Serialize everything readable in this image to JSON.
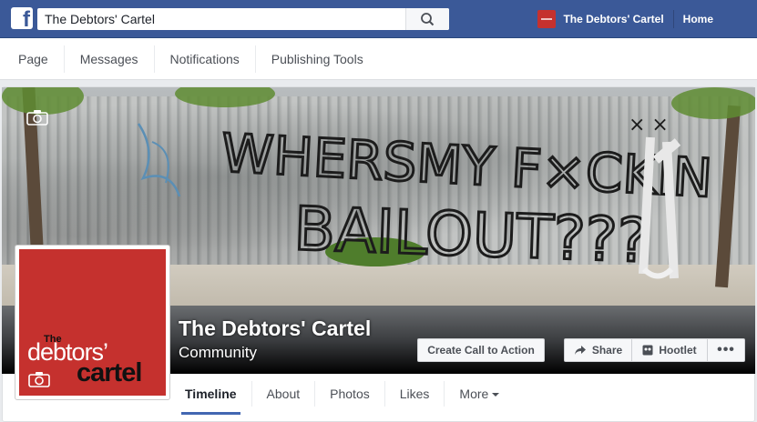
{
  "topbar": {
    "search_value": "The Debtors' Cartel",
    "page_link": "The Debtors' Cartel",
    "home": "Home",
    "brand_color": "#3b5998"
  },
  "subnav": {
    "items": [
      "Page",
      "Messages",
      "Notifications",
      "Publishing Tools"
    ]
  },
  "cover": {
    "graffiti_line1": "WHERSMY F×CKIN",
    "graffiti_line2": "BAILOUT???"
  },
  "page": {
    "name": "The Debtors' Cartel",
    "category": "Community"
  },
  "profile_logo": {
    "the": "The",
    "debtors": "debtors’",
    "cartel": "cartel",
    "color": "#c5312e"
  },
  "actions": {
    "cta": "Create Call to Action",
    "share": "Share",
    "hootlet": "Hootlet",
    "more": "•••"
  },
  "tabs": {
    "items": [
      "Timeline",
      "About",
      "Photos",
      "Likes",
      "More"
    ]
  },
  "icons": [
    "facebook-logo",
    "search-icon",
    "camera-icon",
    "share-arrow-icon",
    "hootlet-icon",
    "more-dots-icon",
    "caret-down-icon"
  ]
}
